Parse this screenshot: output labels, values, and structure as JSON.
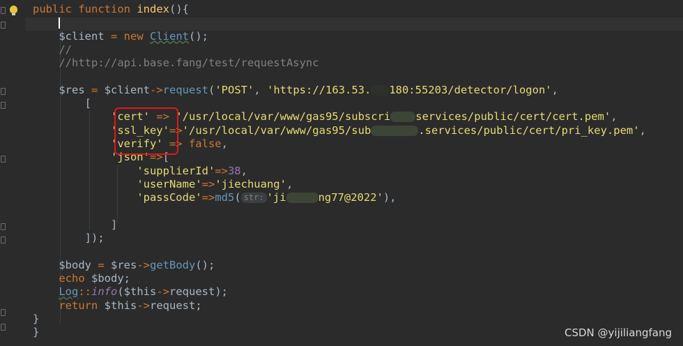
{
  "editor": {
    "lines": {
      "l1": {
        "kw": "public function",
        "name": "index",
        "rest": "(){"
      },
      "l3": {
        "var": "$client",
        "eq": " = ",
        "kw": "new",
        "cls": "Client",
        "end": "();"
      },
      "l4": {
        "cmt": "//"
      },
      "l5": {
        "cmt": "//http://api.base.fang/test/requestAsync"
      },
      "l7": {
        "var": "$res",
        "eq": " = ",
        "var2": "$client",
        "arrow": "->",
        "meth": "request",
        "open": "(",
        "s1": "'POST'",
        "comma": ", ",
        "s2a": "'https://163.53.",
        "s2b": "180:55203/detector/logon'",
        "end": ","
      },
      "l8": {
        "text": "["
      },
      "l9": {
        "key": "'cert'",
        "arrow": " => ",
        "vala": "'/usr/local/var/www/gas95/subscri",
        "valb": "services/public/cert/cert.pem'",
        "end": ","
      },
      "l10": {
        "key": "'ssl_key'",
        "arrow": "=>",
        "vala": "'/usr/local/var/www/gas95/sub",
        "valb": ".services/public/cert/pri_key.pem'",
        "end": ","
      },
      "l11": {
        "key": "'verify'",
        "arrow": " => ",
        "val": "false",
        "end": ","
      },
      "l12": {
        "key": "'json'",
        "arrow": "=>",
        "open": "["
      },
      "l13": {
        "key": "'supplierId'",
        "arrow": "=>",
        "num": "38",
        "end": ","
      },
      "l14": {
        "key": "'userName'",
        "arrow": "=>",
        "val": "'jiechuang'",
        "end": ","
      },
      "l15": {
        "key": "'passCode'",
        "arrow": "=>",
        "meth": "md5",
        "open": "(",
        "hint": "str:",
        "vala": "'ji",
        "valb": "ng77@2022'",
        "end": "),"
      },
      "l17": {
        "text": "]"
      },
      "l18": {
        "text": "]);"
      },
      "l20": {
        "var": "$body",
        "eq": " = ",
        "var2": "$res",
        "arrow": "->",
        "meth": "getBody",
        "end": "();"
      },
      "l21": {
        "kw": "echo",
        "rest": " $body;"
      },
      "l22": {
        "cls": "Log",
        "sep": "::",
        "meth": "info",
        "open": "(",
        "var": "$this",
        "arrow": "->",
        "prop": "request",
        "end": ");"
      },
      "l23": {
        "kw": "return",
        "var": " $this",
        "arrow": "->",
        "prop": "request",
        "end": ";"
      },
      "l24": {
        "text": "}"
      },
      "l25": {
        "text": "}"
      }
    },
    "colors": {
      "background": "#2b2b2b",
      "keyword": "#cc7832",
      "string": "#6a8759",
      "highlight_box": "#e01818"
    }
  },
  "watermark": "CSDN @yijiliangfang"
}
